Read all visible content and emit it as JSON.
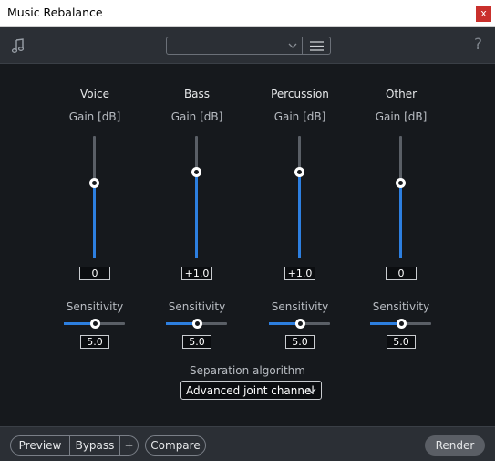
{
  "window": {
    "title": "Music Rebalance",
    "close_label": "x"
  },
  "toolbar": {
    "preset_value": "",
    "help_label": "?"
  },
  "channels": [
    {
      "name": "Voice",
      "gain_label": "Gain [dB]",
      "gain_value": "0",
      "gain_level": 0.62,
      "sensitivity_label": "Sensitivity",
      "sensitivity_value": "5.0",
      "sensitivity_level": 0.5
    },
    {
      "name": "Bass",
      "gain_label": "Gain [dB]",
      "gain_value": "+1.0",
      "gain_level": 0.71,
      "sensitivity_label": "Sensitivity",
      "sensitivity_value": "5.0",
      "sensitivity_level": 0.5
    },
    {
      "name": "Percussion",
      "gain_label": "Gain [dB]",
      "gain_value": "+1.0",
      "gain_level": 0.71,
      "sensitivity_label": "Sensitivity",
      "sensitivity_value": "5.0",
      "sensitivity_level": 0.5
    },
    {
      "name": "Other",
      "gain_label": "Gain [dB]",
      "gain_value": "0",
      "gain_level": 0.62,
      "sensitivity_label": "Sensitivity",
      "sensitivity_value": "5.0",
      "sensitivity_level": 0.5
    }
  ],
  "separation": {
    "label": "Separation algorithm",
    "value": "Advanced joint channel"
  },
  "bottombar": {
    "preview_label": "Preview",
    "bypass_label": "Bypass",
    "plus_label": "+",
    "compare_label": "Compare",
    "render_label": "Render"
  },
  "colors": {
    "accent": "#2d7fe0",
    "background": "#16191d",
    "toolbar": "#2b2f35"
  }
}
